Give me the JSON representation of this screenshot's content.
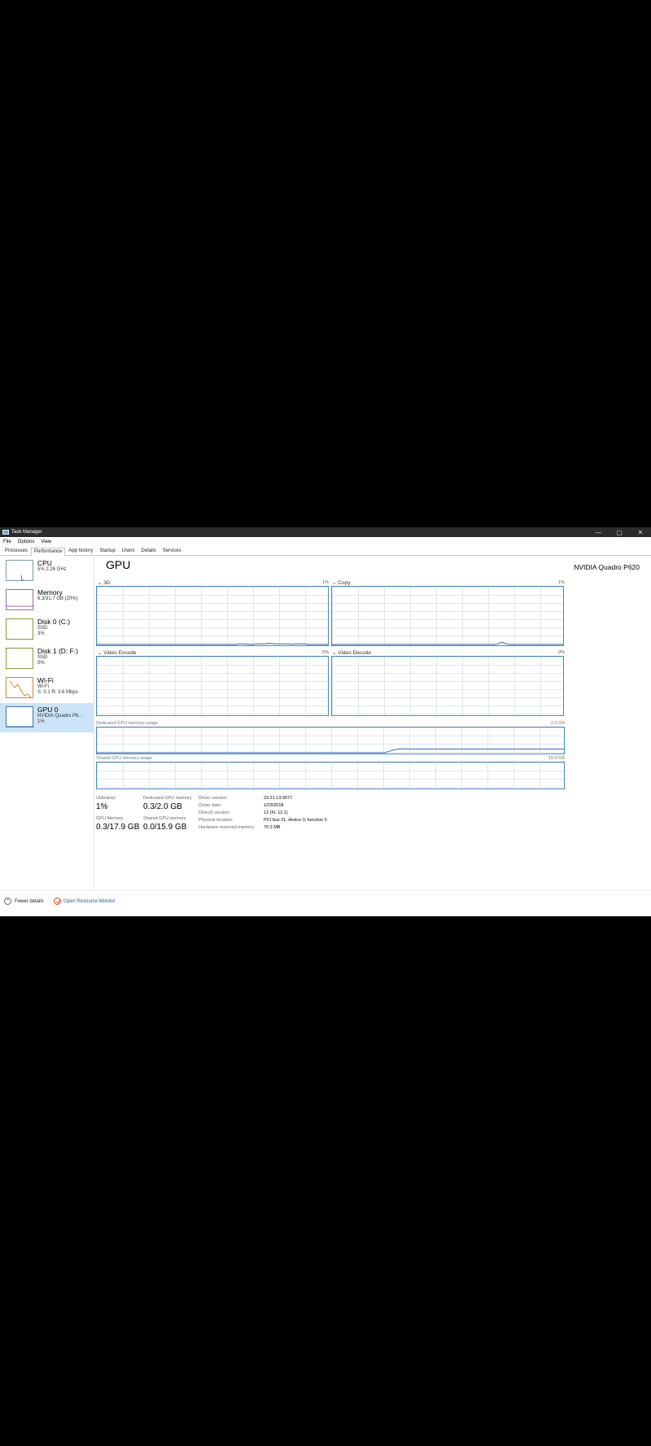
{
  "window": {
    "title": "Task Manager",
    "minimize": "—",
    "maximize": "▢",
    "close": "✕"
  },
  "menu": [
    "File",
    "Options",
    "View"
  ],
  "tabs": [
    "Processes",
    "Performance",
    "App history",
    "Startup",
    "Users",
    "Details",
    "Services"
  ],
  "sidebar": [
    {
      "name": "CPU",
      "line1": "5% 2.26 GHz",
      "line2": "",
      "line3": ""
    },
    {
      "name": "Memory",
      "line1": "6.3/31.7 GB (20%)",
      "line2": "",
      "line3": ""
    },
    {
      "name": "Disk 0 (C:)",
      "line1": "SSD",
      "line2": "3%",
      "line3": ""
    },
    {
      "name": "Disk 1 (D: F:)",
      "line1": "SSD",
      "line2": "0%",
      "line3": ""
    },
    {
      "name": "Wi-Fi",
      "line1": "Wi-Fi",
      "line2": "S: 0.1 R: 3.6 Mbps",
      "line3": ""
    },
    {
      "name": "GPU 0",
      "line1": "NVIDIA Quadro P6...",
      "line2": "1%",
      "line3": ""
    }
  ],
  "gpu": {
    "title": "GPU",
    "model": "NVIDIA Quadro P620",
    "engines": [
      {
        "label": "3D",
        "pct": "1%",
        "usage": [
          0,
          0,
          0,
          0,
          0,
          0,
          0,
          0,
          0,
          0,
          0,
          0,
          0,
          0,
          0,
          0,
          0,
          0,
          0,
          0,
          0,
          0,
          0,
          0,
          0,
          0,
          0,
          0,
          0,
          0,
          0,
          0,
          0,
          0,
          0,
          0,
          0,
          0,
          0,
          0,
          0,
          0,
          0,
          0,
          0,
          0,
          0,
          0,
          0,
          0,
          0,
          0,
          0,
          0,
          0,
          0,
          0,
          0,
          0,
          0,
          0,
          1,
          1,
          1,
          1,
          0,
          0,
          0,
          1,
          1,
          1,
          1,
          1,
          2,
          2,
          2,
          1,
          1,
          1,
          1,
          1,
          1,
          1,
          1,
          0,
          1,
          1,
          1,
          1,
          1,
          0,
          0,
          0,
          0,
          0,
          0,
          0,
          0,
          0,
          0
        ]
      },
      {
        "label": "Copy",
        "pct": "1%",
        "usage": [
          0,
          0,
          0,
          0,
          0,
          0,
          0,
          0,
          0,
          0,
          0,
          0,
          0,
          0,
          0,
          0,
          0,
          0,
          0,
          0,
          0,
          0,
          0,
          0,
          0,
          0,
          0,
          0,
          0,
          0,
          0,
          0,
          0,
          0,
          0,
          0,
          0,
          0,
          0,
          0,
          0,
          0,
          0,
          0,
          0,
          0,
          0,
          0,
          0,
          0,
          0,
          0,
          0,
          0,
          0,
          0,
          0,
          0,
          0,
          0,
          0,
          0,
          0,
          0,
          0,
          0,
          0,
          0,
          0,
          0,
          0,
          1,
          3,
          4,
          2,
          1,
          0,
          0,
          0,
          0,
          0,
          0,
          0,
          0,
          0,
          0,
          0,
          0,
          0,
          0,
          0,
          0,
          0,
          0,
          0,
          0,
          0,
          0,
          0,
          0
        ]
      },
      {
        "label": "Video Encode",
        "pct": "0%",
        "usage": []
      },
      {
        "label": "Video Decode",
        "pct": "0%",
        "usage": []
      }
    ],
    "dedicated": {
      "label": "Dedicated GPU memory usage",
      "max": "2.0 GB",
      "usage": [
        0,
        0,
        0,
        0,
        0,
        0,
        0,
        0,
        0,
        0,
        0,
        0,
        0,
        0,
        0,
        0,
        0,
        0,
        0,
        0,
        0,
        0,
        0,
        0,
        0,
        0,
        0,
        0,
        0,
        0,
        0,
        0,
        0,
        0,
        0,
        0,
        0,
        0,
        0,
        0,
        0,
        0,
        0,
        0,
        0,
        0,
        0,
        0,
        0,
        0,
        0,
        0,
        0,
        0,
        0,
        0,
        0,
        0,
        0,
        0,
        0,
        0,
        6,
        12,
        15,
        16,
        15,
        15,
        15,
        15,
        15,
        15,
        15,
        15,
        15,
        15,
        15,
        15,
        15,
        15,
        15,
        15,
        15,
        15,
        15,
        15,
        15,
        15,
        15,
        15,
        15,
        15,
        15,
        15,
        15,
        15,
        15,
        15,
        15,
        15
      ]
    },
    "shared": {
      "label": "Shared GPU memory usage",
      "max": "15.9 GB",
      "usage": []
    },
    "stats": {
      "utilization": {
        "label": "Utilization",
        "value": "1%"
      },
      "dedicated": {
        "label": "Dedicated GPU memory",
        "value": "0.3/2.0 GB"
      },
      "gpu_memory": {
        "label": "GPU Memory",
        "value": "0.3/17.9 GB"
      },
      "shared": {
        "label": "Shared GPU memory",
        "value": "0.0/15.9 GB"
      }
    },
    "props": [
      {
        "label": "Driver version:",
        "value": "23.21.13.9077"
      },
      {
        "label": "Driver date:",
        "value": "1/23/2018"
      },
      {
        "label": "DirectX version:",
        "value": "12 (FL 12.1)"
      },
      {
        "label": "Physical location:",
        "value": "PCI bus 21, device 0, function 0"
      },
      {
        "label": "Hardware reserved memory:",
        "value": "70.3 MB"
      }
    ]
  },
  "footer": {
    "fewer": "Fewer details",
    "resource_monitor": "Open Resource Monitor"
  }
}
